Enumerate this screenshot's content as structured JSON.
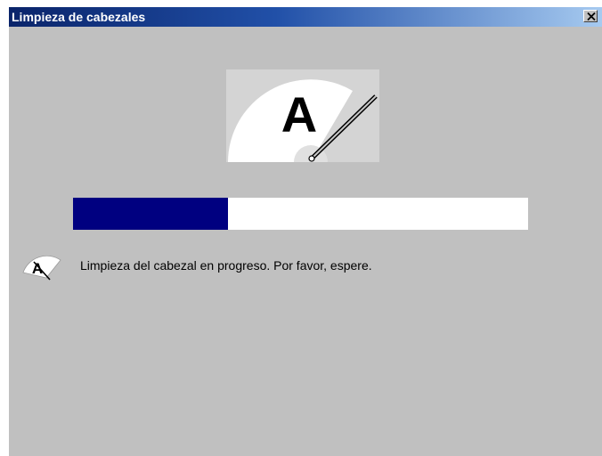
{
  "window": {
    "title": "Limpieza de cabezales",
    "close_label": "X"
  },
  "hero": {
    "glyph": "A",
    "icon": "print-head-cleaning-gauge-icon"
  },
  "progress": {
    "fraction": 0.34,
    "fill_color": "#000080",
    "track_color": "#ffffff"
  },
  "status": {
    "icon": "small-head-cleaning-icon",
    "glyph": "A",
    "message": "Limpieza del cabezal en progreso. Por favor, espere."
  },
  "colors": {
    "titlebar_start": "#0a246a",
    "titlebar_end": "#a6caf0",
    "dialog_background": "#c0c0c0"
  }
}
